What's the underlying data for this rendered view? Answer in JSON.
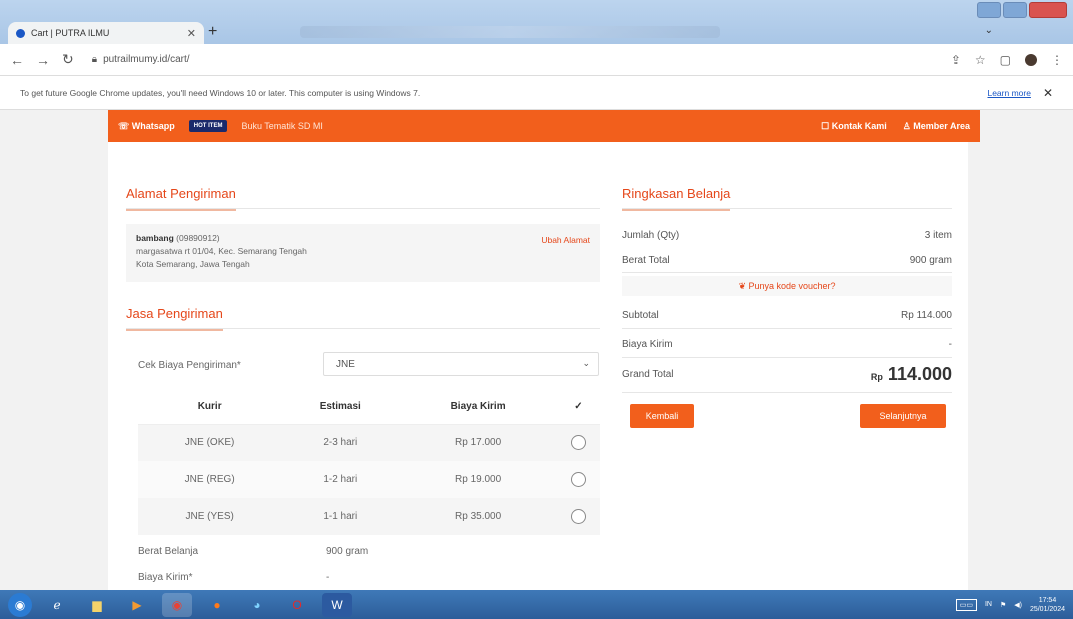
{
  "browser": {
    "tab_title": "Cart | PUTRA ILMU",
    "url": "putrailmumy.id/cart/",
    "info_text": "To get future Google Chrome updates, you'll need Windows 10 or later. This computer is using Windows 7.",
    "learn_more": "Learn more"
  },
  "topnav": {
    "whatsapp": "Whatsapp",
    "badge": "HOT ITEM",
    "promo": "Buku Tematik SD MI",
    "contact": "Kontak Kami",
    "member": "Member Area"
  },
  "address": {
    "section_title": "Alamat Pengiriman",
    "name": "bambang",
    "phone": "(09890912)",
    "line1": "margasatwa rt 01/04, Kec. Semarang Tengah",
    "line2": "Kota Semarang, Jawa Tengah",
    "change": "Ubah Alamat"
  },
  "shipping": {
    "section_title": "Jasa Pengiriman",
    "check_label": "Cek Biaya Pengiriman*",
    "selected_courier": "JNE",
    "headers": [
      "Kurir",
      "Estimasi",
      "Biaya Kirim",
      "✓"
    ],
    "rows": [
      {
        "kurir": "JNE (OKE)",
        "estimasi": "2-3 hari",
        "biaya": "Rp 17.000"
      },
      {
        "kurir": "JNE (REG)",
        "estimasi": "1-2 hari",
        "biaya": "Rp 19.000"
      },
      {
        "kurir": "JNE (YES)",
        "estimasi": "1-1 hari",
        "biaya": "Rp 35.000"
      }
    ],
    "weight_label": "Berat Belanja",
    "weight_value": "900 gram",
    "cost_label": "Biaya Kirim*",
    "cost_value": "-"
  },
  "summary": {
    "section_title": "Ringkasan Belanja",
    "qty_label": "Jumlah (Qty)",
    "qty_value": "3 item",
    "weight_label": "Berat Total",
    "weight_value": "900 gram",
    "voucher": "Punya kode voucher?",
    "subtotal_label": "Subtotal",
    "subtotal_value": "Rp 114.000",
    "shipping_label": "Biaya Kirim",
    "shipping_value": "-",
    "grand_label": "Grand Total",
    "grand_currency": "Rp",
    "grand_value": "114.000",
    "back_button": "Kembali",
    "next_button": "Selanjutnya"
  },
  "taskbar": {
    "lang": "IN",
    "time": "17:54",
    "date": "25/01/2024"
  }
}
